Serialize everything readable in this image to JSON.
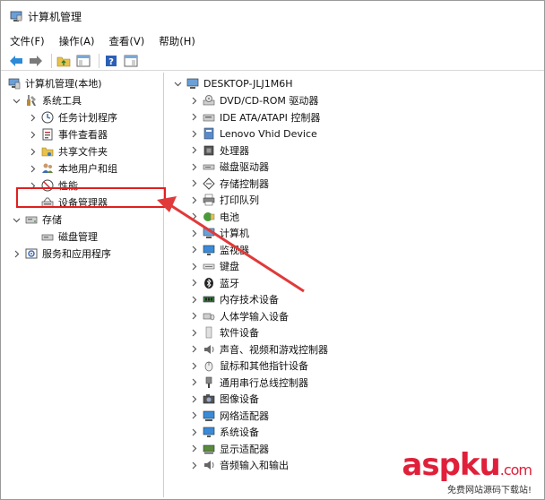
{
  "window": {
    "title": "计算机管理"
  },
  "menu": [
    "文件(F)",
    "操作(A)",
    "查看(V)",
    "帮助(H)"
  ],
  "left_tree": [
    {
      "label": "计算机管理(本地)",
      "level": 0,
      "chevron": "",
      "icon": "computer-mgmt-icon"
    },
    {
      "label": "系统工具",
      "level": 1,
      "chevron": "v",
      "icon": "system-tools-icon"
    },
    {
      "label": "任务计划程序",
      "level": 2,
      "chevron": ">",
      "icon": "task-scheduler-icon"
    },
    {
      "label": "事件查看器",
      "level": 2,
      "chevron": ">",
      "icon": "event-viewer-icon"
    },
    {
      "label": "共享文件夹",
      "level": 2,
      "chevron": ">",
      "icon": "shared-folder-icon"
    },
    {
      "label": "本地用户和组",
      "level": 2,
      "chevron": ">",
      "icon": "users-icon"
    },
    {
      "label": "性能",
      "level": 2,
      "chevron": ">",
      "icon": "performance-icon"
    },
    {
      "label": "设备管理器",
      "level": 2,
      "chevron": "",
      "icon": "device-manager-icon"
    },
    {
      "label": "存储",
      "level": 1,
      "chevron": "v",
      "icon": "storage-icon"
    },
    {
      "label": "磁盘管理",
      "level": 2,
      "chevron": "",
      "icon": "disk-mgmt-icon"
    },
    {
      "label": "服务和应用程序",
      "level": 1,
      "chevron": ">",
      "icon": "services-icon"
    }
  ],
  "device_tree": {
    "root": "DESKTOP-JLJ1M6H",
    "items": [
      {
        "label": "DVD/CD-ROM 驱动器",
        "icon": "dvd-icon"
      },
      {
        "label": "IDE ATA/ATAPI 控制器",
        "icon": "ide-icon"
      },
      {
        "label": "Lenovo Vhid Device",
        "icon": "lenovo-icon"
      },
      {
        "label": "处理器",
        "icon": "cpu-icon"
      },
      {
        "label": "磁盘驱动器",
        "icon": "disk-icon"
      },
      {
        "label": "存储控制器",
        "icon": "storage-ctrl-icon"
      },
      {
        "label": "打印队列",
        "icon": "printer-icon"
      },
      {
        "label": "电池",
        "icon": "battery-icon"
      },
      {
        "label": "计算机",
        "icon": "computer-icon"
      },
      {
        "label": "监视器",
        "icon": "monitor-icon"
      },
      {
        "label": "键盘",
        "icon": "keyboard-icon"
      },
      {
        "label": "蓝牙",
        "icon": "bluetooth-icon"
      },
      {
        "label": "内存技术设备",
        "icon": "memory-icon"
      },
      {
        "label": "人体学输入设备",
        "icon": "hid-icon"
      },
      {
        "label": "软件设备",
        "icon": "software-device-icon"
      },
      {
        "label": "声音、视频和游戏控制器",
        "icon": "sound-icon"
      },
      {
        "label": "鼠标和其他指针设备",
        "icon": "mouse-icon"
      },
      {
        "label": "通用串行总线控制器",
        "icon": "usb-icon"
      },
      {
        "label": "图像设备",
        "icon": "camera-icon"
      },
      {
        "label": "网络适配器",
        "icon": "network-icon"
      },
      {
        "label": "系统设备",
        "icon": "system-device-icon"
      },
      {
        "label": "显示适配器",
        "icon": "display-icon"
      },
      {
        "label": "音频输入和输出",
        "icon": "audio-io-icon"
      }
    ]
  },
  "watermark": {
    "logo_main": "aspku",
    "logo_suffix": ".com",
    "subtitle": "免费网站源码下载站!"
  },
  "colors": {
    "highlight": "#e02020",
    "arrow": "#e03a3a",
    "watermark": "#e0203a"
  }
}
